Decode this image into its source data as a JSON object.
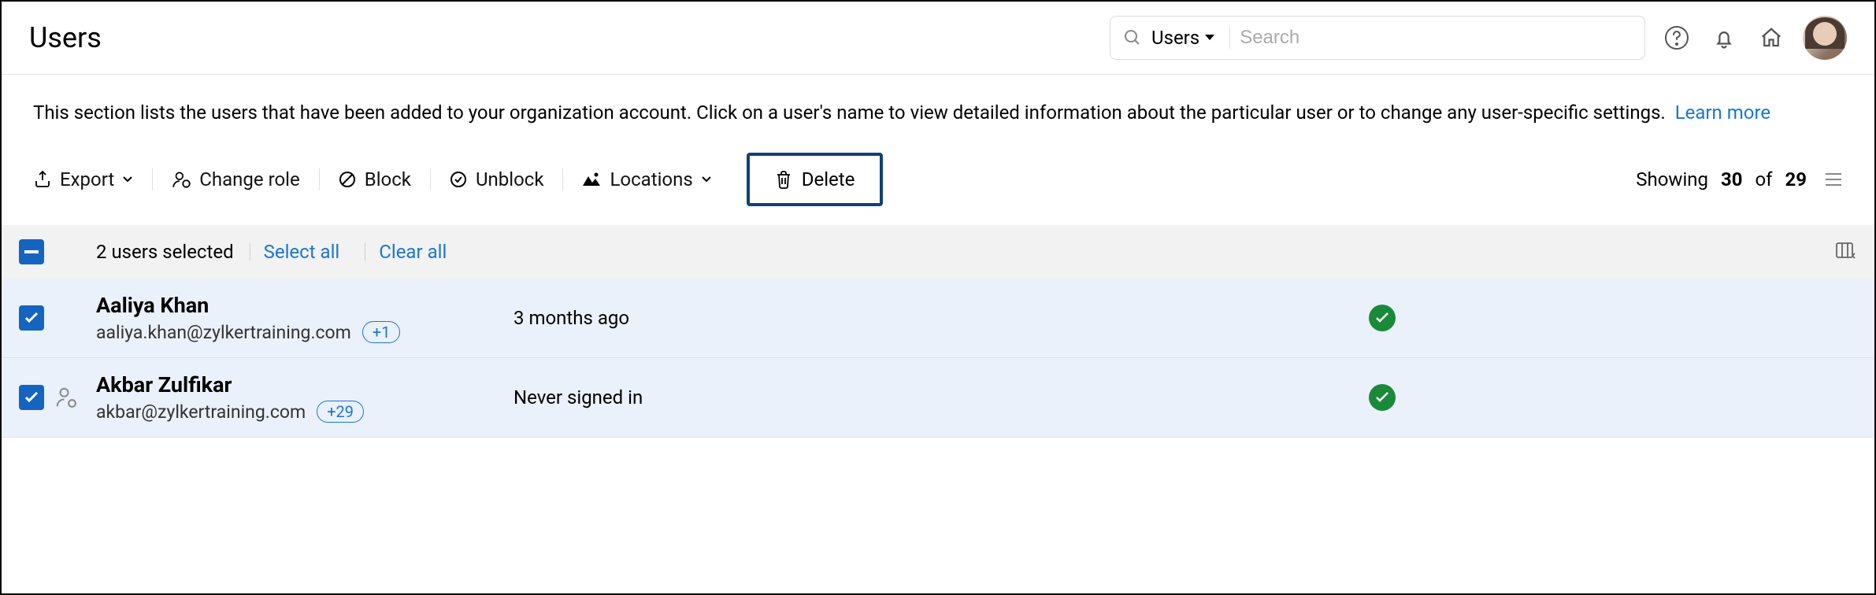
{
  "header": {
    "title": "Users",
    "search_scope": "Users",
    "search_placeholder": "Search"
  },
  "description": {
    "text": "This section lists the users that have been added to your organization account. Click on a user's name to view detailed information about the particular user or to change any user-specific settings.",
    "learn_more": "Learn more"
  },
  "toolbar": {
    "export": "Export",
    "change_role": "Change role",
    "block": "Block",
    "unblock": "Unblock",
    "locations": "Locations",
    "delete": "Delete",
    "showing_label": "Showing",
    "showing_count": "30",
    "showing_of": "of",
    "showing_total": "29"
  },
  "selection": {
    "count_text": "2 users selected",
    "select_all": "Select all",
    "clear_all": "Clear all"
  },
  "rows": [
    {
      "name": "Aaliya Khan",
      "email": "aaliya.khan@zylkertraining.com",
      "badge": "+1",
      "signin": "3 months ago",
      "checked": true,
      "status_ok": true
    },
    {
      "name": "Akbar Zulfikar",
      "email": "akbar@zylkertraining.com",
      "badge": "+29",
      "signin": "Never signed in",
      "checked": true,
      "status_ok": true,
      "has_role_icon": true
    }
  ]
}
